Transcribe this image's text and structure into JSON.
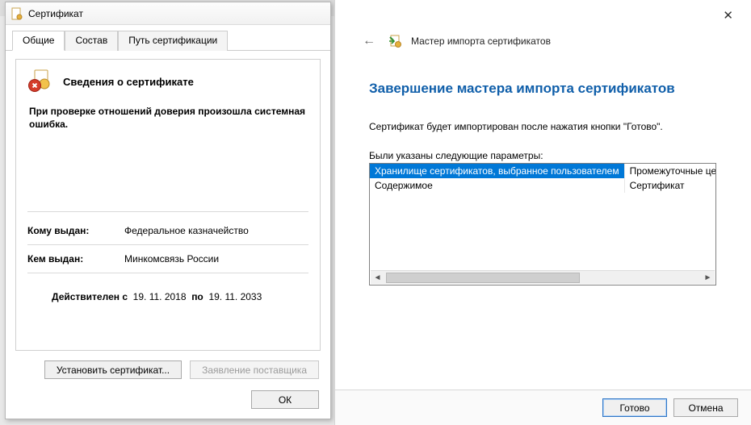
{
  "cert_dialog": {
    "title": "Сертификат",
    "tabs": {
      "general": "Общие",
      "details": "Состав",
      "path": "Путь сертификации"
    },
    "header": "Сведения о сертификате",
    "error_text": "При проверке отношений доверия произошла системная ошибка.",
    "issued_to_label": "Кому выдан:",
    "issued_to": "Федеральное казначейство",
    "issued_by_label": "Кем выдан:",
    "issued_by": "Минкомсвязь России",
    "valid_label": "Действителен с",
    "valid_from": "19. 11. 2018",
    "valid_sep": "по",
    "valid_to": "19. 11. 2033",
    "install_btn": "Установить сертификат...",
    "supplier_btn": "Заявление поставщика",
    "ok_btn": "ОК"
  },
  "wizard": {
    "head_title": "Мастер импорта сертификатов",
    "h1": "Завершение мастера импорта сертификатов",
    "p": "Сертификат будет импортирован после нажатия кнопки \"Готово\".",
    "params_label": "Были указаны следующие параметры:",
    "rows": [
      {
        "k": "Хранилище сертификатов, выбранное пользователем",
        "v": "Промежуточные центры сер"
      },
      {
        "k": "Содержимое",
        "v": "Сертификат"
      }
    ],
    "finish": "Готово",
    "cancel": "Отмена"
  }
}
